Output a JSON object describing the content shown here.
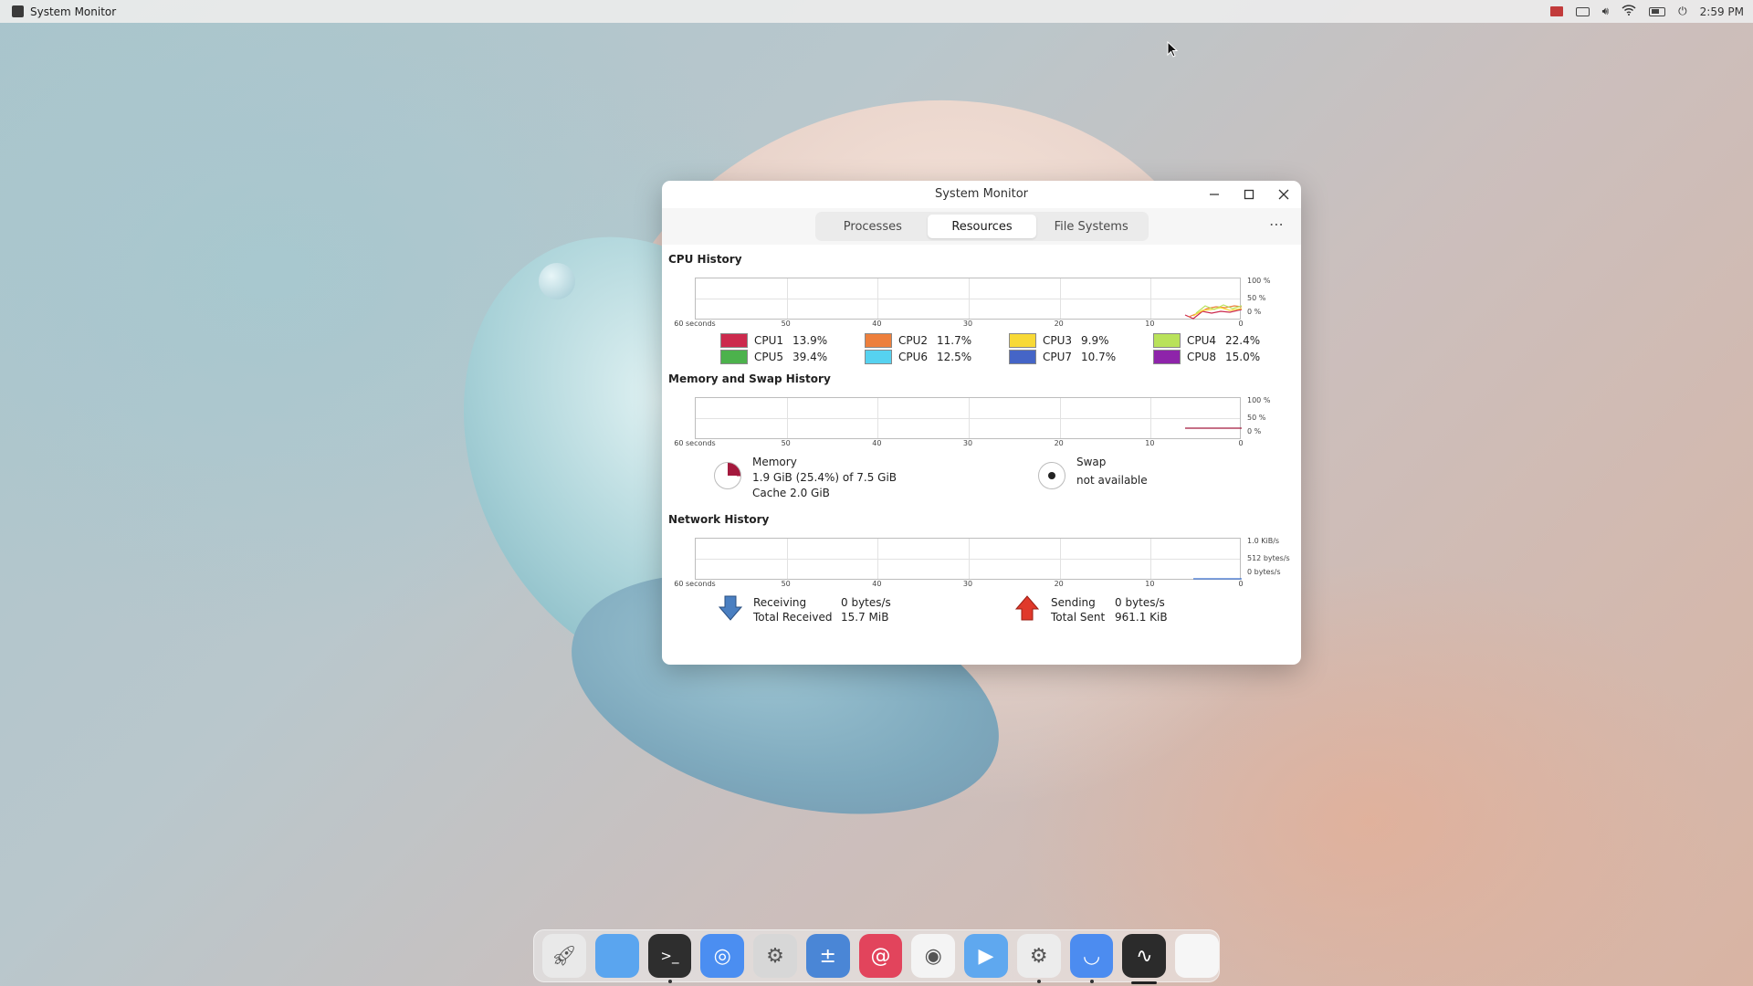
{
  "topbar": {
    "app_title": "System Monitor",
    "clock": "2:59 PM"
  },
  "window": {
    "title": "System Monitor",
    "tabs": [
      {
        "label": "Processes",
        "active": false
      },
      {
        "label": "Resources",
        "active": true
      },
      {
        "label": "File Systems",
        "active": false
      }
    ],
    "menu_label": "⋯"
  },
  "cpu": {
    "title": "CPU History",
    "x_ticks": [
      "60 seconds",
      "50",
      "40",
      "30",
      "20",
      "10",
      "0"
    ],
    "y_ticks": [
      "100 %",
      "50 %",
      "0 %"
    ],
    "cores": [
      {
        "name": "CPU1",
        "value": "13.9%",
        "color": "#cc2a4d"
      },
      {
        "name": "CPU2",
        "value": "11.7%",
        "color": "#ed7f3c"
      },
      {
        "name": "CPU3",
        "value": "9.9%",
        "color": "#f8d936"
      },
      {
        "name": "CPU4",
        "value": "22.4%",
        "color": "#b9e25a"
      },
      {
        "name": "CPU5",
        "value": "39.4%",
        "color": "#4cb24c"
      },
      {
        "name": "CPU6",
        "value": "12.5%",
        "color": "#56d2f0"
      },
      {
        "name": "CPU7",
        "value": "10.7%",
        "color": "#4565c7"
      },
      {
        "name": "CPU8",
        "value": "15.0%",
        "color": "#8e24aa"
      }
    ]
  },
  "memory": {
    "title": "Memory and Swap History",
    "x_ticks": [
      "60 seconds",
      "50",
      "40",
      "30",
      "20",
      "10",
      "0"
    ],
    "y_ticks": [
      "100 %",
      "50 %",
      "0 %"
    ],
    "mem_label": "Memory",
    "mem_usage": "1.9 GiB (25.4%) of 7.5 GiB",
    "mem_cache": "Cache 2.0 GiB",
    "swap_label": "Swap",
    "swap_status": "not available",
    "mem_color": "#a4193d"
  },
  "network": {
    "title": "Network History",
    "x_ticks": [
      "60 seconds",
      "50",
      "40",
      "30",
      "20",
      "10",
      "0"
    ],
    "y_ticks": [
      "1.0 KiB/s",
      "512 bytes/s",
      "0 bytes/s"
    ],
    "receiving_label": "Receiving",
    "receiving_value": "0 bytes/s",
    "total_received_label": "Total Received",
    "total_received_value": "15.7 MiB",
    "sending_label": "Sending",
    "sending_value": "0 bytes/s",
    "total_sent_label": "Total Sent",
    "total_sent_value": "961.1 KiB"
  },
  "dock": {
    "items": [
      {
        "name": "launcher-icon",
        "color": "#e9e9e9"
      },
      {
        "name": "files-icon",
        "color": "#5aa5ef"
      },
      {
        "name": "terminal-icon",
        "color": "#2e2e2e"
      },
      {
        "name": "browser-icon",
        "color": "#4b8ef1"
      },
      {
        "name": "settings-icon",
        "color": "#d7d7d7"
      },
      {
        "name": "calculator-icon",
        "color": "#4a86d6"
      },
      {
        "name": "debian-icon",
        "color": "#e2445c"
      },
      {
        "name": "screenshot-icon",
        "color": "#f4f4f4"
      },
      {
        "name": "media-player-icon",
        "color": "#5fa8ef"
      },
      {
        "name": "system-settings-icon",
        "color": "#ececec"
      },
      {
        "name": "app-store-icon",
        "color": "#4c8cf0"
      },
      {
        "name": "system-monitor-icon",
        "color": "#2b2b2b"
      },
      {
        "name": "trash-icon",
        "color": "#f6f6f6"
      }
    ]
  }
}
